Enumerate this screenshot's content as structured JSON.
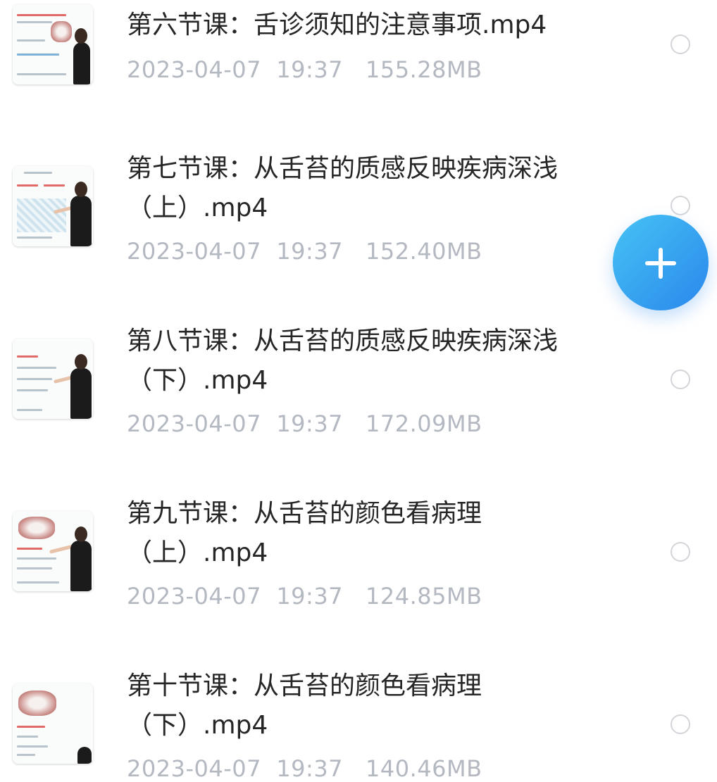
{
  "files": [
    {
      "title": "第六节课：舌诊须知的注意事项.mp4",
      "date": "2023-04-07",
      "time": "19:37",
      "size": "155.28MB",
      "thumb_icon": "lecture-video-thumbnail-icon"
    },
    {
      "title": "第七节课：从舌苔的质感反映疾病深浅（上）.mp4",
      "date": "2023-04-07",
      "time": "19:37",
      "size": "152.40MB",
      "thumb_icon": "lecture-video-thumbnail-icon"
    },
    {
      "title": "第八节课：从舌苔的质感反映疾病深浅（下）.mp4",
      "date": "2023-04-07",
      "time": "19:37",
      "size": "172.09MB",
      "thumb_icon": "lecture-video-thumbnail-icon"
    },
    {
      "title": "第九节课：从舌苔的颜色看病理（上）.mp4",
      "date": "2023-04-07",
      "time": "19:37",
      "size": "124.85MB",
      "thumb_icon": "lecture-video-thumbnail-icon"
    },
    {
      "title": "第十节课：从舌苔的颜色看病理（下）.mp4",
      "date": "2023-04-07",
      "time": "19:37",
      "size": "140.46MB",
      "thumb_icon": "lecture-video-thumbnail-icon"
    }
  ],
  "fab": {
    "icon": "plus-icon",
    "color_from": "#46c3f4",
    "color_to": "#2a87ec"
  },
  "colors": {
    "title": "#262626",
    "meta": "#b3b8c1",
    "radio_border": "#d3d5d9"
  }
}
